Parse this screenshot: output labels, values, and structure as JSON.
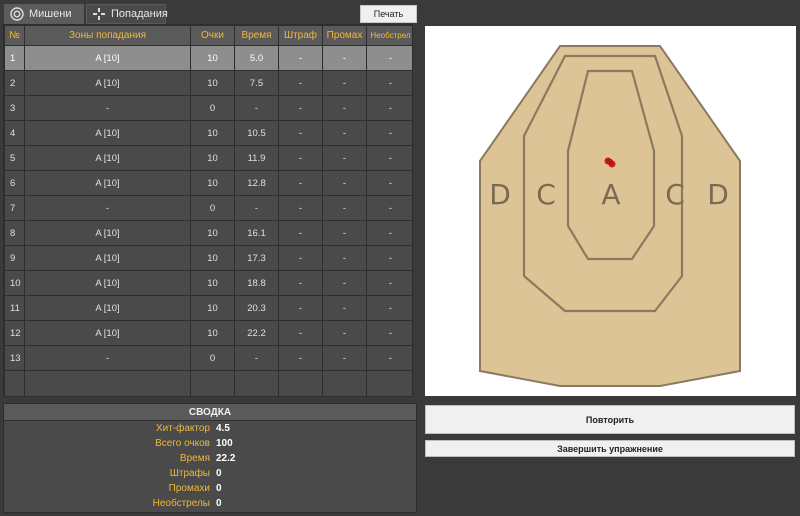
{
  "tabs": [
    {
      "label": "Мишени",
      "icon": "target-icon",
      "active": true
    },
    {
      "label": "Попадания",
      "icon": "crosshair-icon",
      "active": false
    }
  ],
  "toolbar": {
    "print_label": "Печать"
  },
  "table": {
    "headers": [
      "№",
      "Зоны попадания",
      "Очки",
      "Время",
      "Штраф",
      "Промах",
      "Необстрел"
    ],
    "rows": [
      [
        "1",
        "A [10]",
        "10",
        "5.0",
        "-",
        "-",
        "-"
      ],
      [
        "2",
        "A [10]",
        "10",
        "7.5",
        "-",
        "-",
        "-"
      ],
      [
        "3",
        "-",
        "0",
        "-",
        "-",
        "-",
        "-"
      ],
      [
        "4",
        "A [10]",
        "10",
        "10.5",
        "-",
        "-",
        "-"
      ],
      [
        "5",
        "A [10]",
        "10",
        "11.9",
        "-",
        "-",
        "-"
      ],
      [
        "6",
        "A [10]",
        "10",
        "12.8",
        "-",
        "-",
        "-"
      ],
      [
        "7",
        "-",
        "0",
        "-",
        "-",
        "-",
        "-"
      ],
      [
        "8",
        "A [10]",
        "10",
        "16.1",
        "-",
        "-",
        "-"
      ],
      [
        "9",
        "A [10]",
        "10",
        "17.3",
        "-",
        "-",
        "-"
      ],
      [
        "10",
        "A [10]",
        "10",
        "18.8",
        "-",
        "-",
        "-"
      ],
      [
        "11",
        "A [10]",
        "10",
        "20.3",
        "-",
        "-",
        "-"
      ],
      [
        "12",
        "A [10]",
        "10",
        "22.2",
        "-",
        "-",
        "-"
      ],
      [
        "13",
        "-",
        "0",
        "-",
        "-",
        "-",
        "-"
      ]
    ],
    "selected_row": 0
  },
  "summary": {
    "title": "СВОДКА",
    "rows": [
      {
        "label": "Хит-фактор",
        "value": "4.5"
      },
      {
        "label": "Всего очков",
        "value": "100"
      },
      {
        "label": "Время",
        "value": "22.2"
      },
      {
        "label": "Штрафы",
        "value": "0"
      },
      {
        "label": "Промахи",
        "value": "0"
      },
      {
        "label": "Необстрелы",
        "value": "0"
      }
    ]
  },
  "target": {
    "zone_labels": [
      "D",
      "C",
      "A",
      "C",
      "D"
    ],
    "colors": {
      "cardboard": "#dcc496",
      "line": "#8a7a60",
      "hit": "#cc1a1a",
      "text": "#7a6a52"
    }
  },
  "actions": {
    "repeat_label": "Повторить",
    "finish_label": "Завершить упражнение"
  },
  "colors": {
    "accent": "#f0b83c",
    "background": "#3a3a3a",
    "selected_row": "#8e8e8e"
  }
}
